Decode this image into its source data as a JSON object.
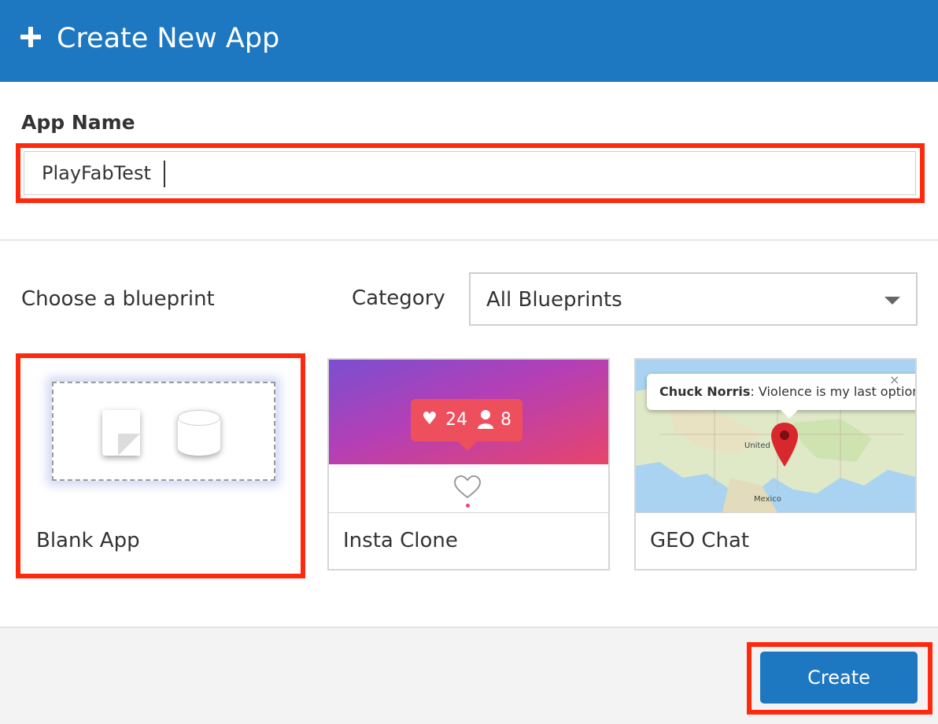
{
  "header": {
    "title": "Create New App",
    "icon": "plus-icon",
    "background_color": "#1e78c1"
  },
  "app_name": {
    "label": "App Name",
    "value": "PlayFabTest"
  },
  "blueprint": {
    "choose_label": "Choose a blueprint",
    "category_label": "Category",
    "category_value": "All Blueprints",
    "cards": [
      {
        "title": "Blank App",
        "selected": true
      },
      {
        "title": "Insta Clone",
        "likes": "24",
        "followers": "8"
      },
      {
        "title": "GEO Chat",
        "callout_author": "Chuck Norris",
        "callout_text": ": Violence is my last option",
        "map_labels": [
          "United",
          "Mexico"
        ]
      }
    ]
  },
  "footer": {
    "create_label": "Create"
  },
  "colors": {
    "accent": "#1e78c1",
    "highlight": "#ff2a0d",
    "insta_badge": "#ee4f5c"
  }
}
